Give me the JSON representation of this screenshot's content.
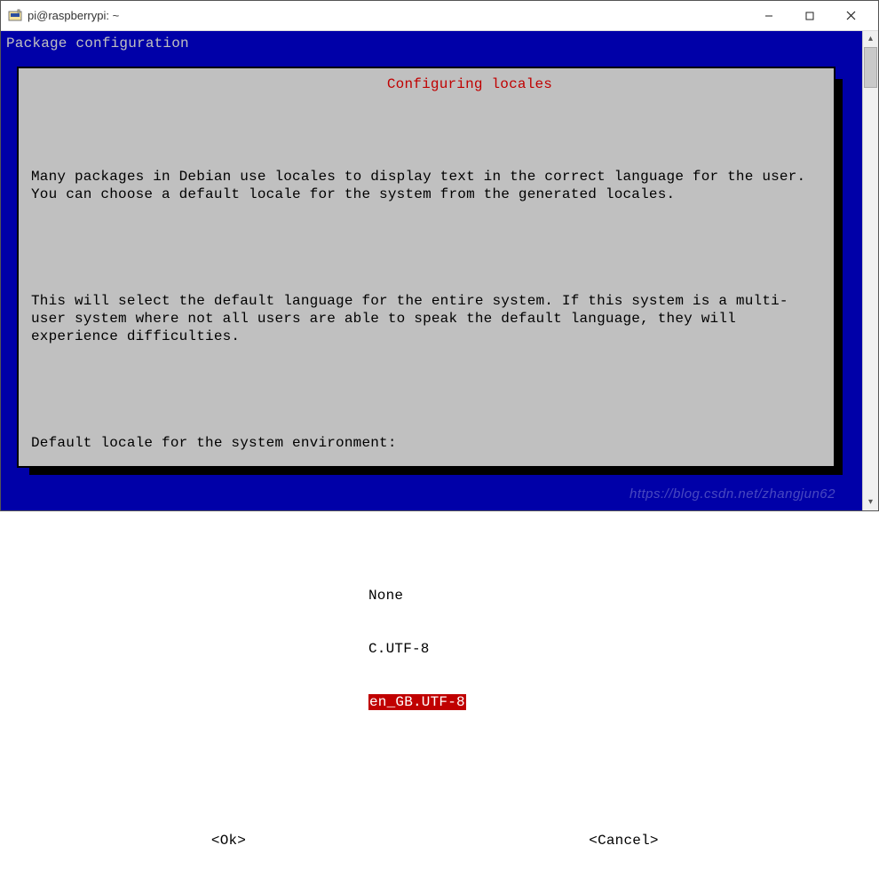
{
  "window": {
    "title": "pi@raspberrypi: ~"
  },
  "terminal": {
    "header": "Package configuration"
  },
  "dialog": {
    "title": " Configuring locales ",
    "paragraph1": "Many packages in Debian use locales to display text in the correct language for the user. You can choose a default locale for the system from the generated locales.",
    "paragraph2": "This will select the default language for the entire system. If this system is a multi-user system where not all users are able to speak the default language, they will experience difficulties.",
    "prompt": "Default locale for the system environment:",
    "options": [
      "None",
      "C.UTF-8",
      "en_GB.UTF-8"
    ],
    "selected_index": 2,
    "ok_label": "<Ok>",
    "cancel_label": "<Cancel>"
  },
  "watermark": "https://blog.csdn.net/zhangjun62"
}
